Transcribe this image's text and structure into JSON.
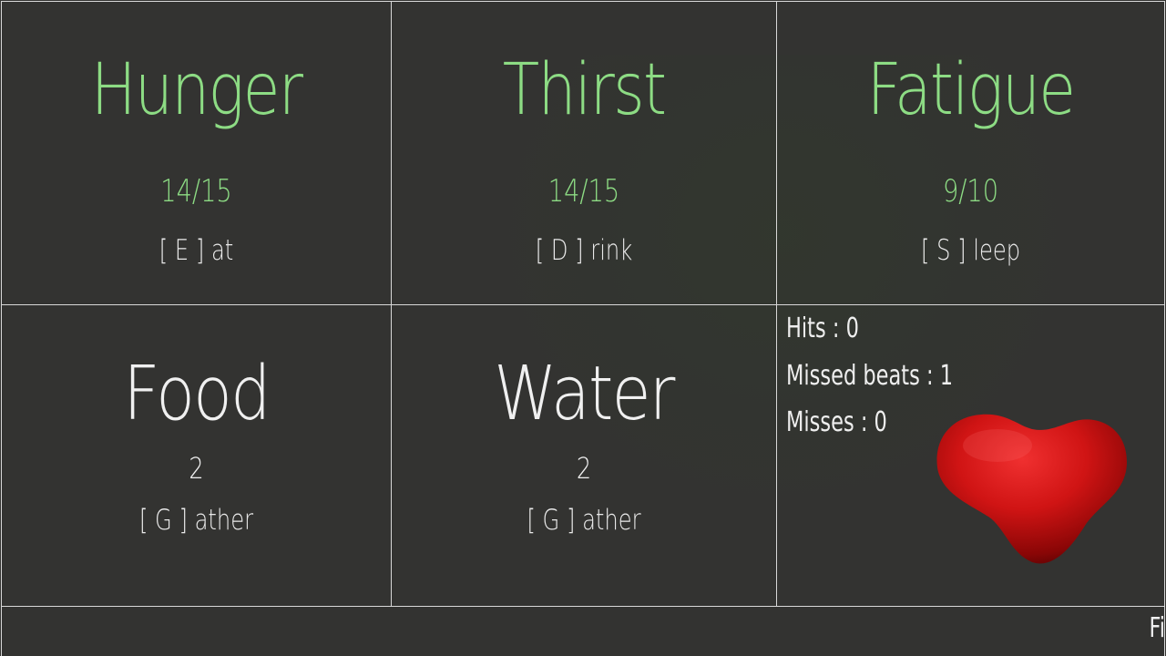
{
  "needs": {
    "hunger": {
      "title": "Hunger",
      "value": "14/15",
      "action": "[ E ] at"
    },
    "thirst": {
      "title": "Thirst",
      "value": "14/15",
      "action": "[ D ] rink"
    },
    "fatigue": {
      "title": "Fatigue",
      "value": "9/10",
      "action": "[ S ] leep"
    }
  },
  "resources": {
    "food": {
      "title": "Food",
      "value": "2",
      "action": "[ G ] ather"
    },
    "water": {
      "title": "Water",
      "value": "2",
      "action": "[ G ] ather"
    }
  },
  "rhythm": {
    "hits": "Hits : 0",
    "missed_beats": "Missed beats : 1",
    "misses": "Misses : 0",
    "heart_icon": "heart-icon"
  },
  "footer": {
    "partial_button_label": "Fi"
  },
  "colors": {
    "background": "#333331",
    "need_text": "#8ddc84",
    "resource_text": "#f0f0f0",
    "grid_line": "#d8d8d8",
    "heart": "#d01010"
  }
}
